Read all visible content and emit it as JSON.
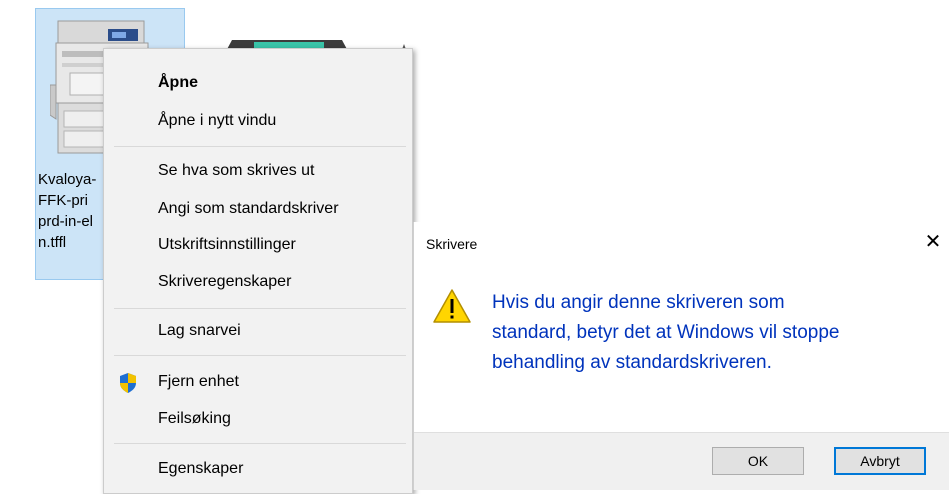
{
  "desktop": {
    "printer_icon": {
      "icon": "printer-icon",
      "label_lines": [
        "Kvaloya-",
        "FFK-pri",
        "prd-in-el",
        "n.tffl"
      ]
    },
    "second_icon": {
      "icon": "printer-device-icon"
    }
  },
  "context_menu": {
    "items": [
      {
        "label": "Åpne",
        "bold": true
      },
      {
        "label": "Åpne i nytt vindu"
      },
      {
        "label": "Se hva som skrives ut"
      },
      {
        "label": "Angi som standardskriver"
      },
      {
        "label": "Utskriftsinnstillinger"
      },
      {
        "label": "Skriveregenskaper"
      },
      {
        "label": "Lag snarvei"
      },
      {
        "label": "Fjern enhet",
        "icon": "uac-shield-icon"
      },
      {
        "label": "Feilsøking"
      },
      {
        "label": "Egenskaper"
      }
    ]
  },
  "dialog": {
    "title": "Skrivere",
    "close_glyph": "✕",
    "icon": "warning-icon",
    "message_lines": [
      "Hvis du angir denne skriveren som",
      "standard, betyr det at Windows vil stoppe",
      "behandling av standardskriveren."
    ],
    "buttons": {
      "ok": "OK",
      "cancel": "Avbryt"
    },
    "colors": {
      "message": "#0033bc",
      "accent": "#0078d7"
    }
  }
}
